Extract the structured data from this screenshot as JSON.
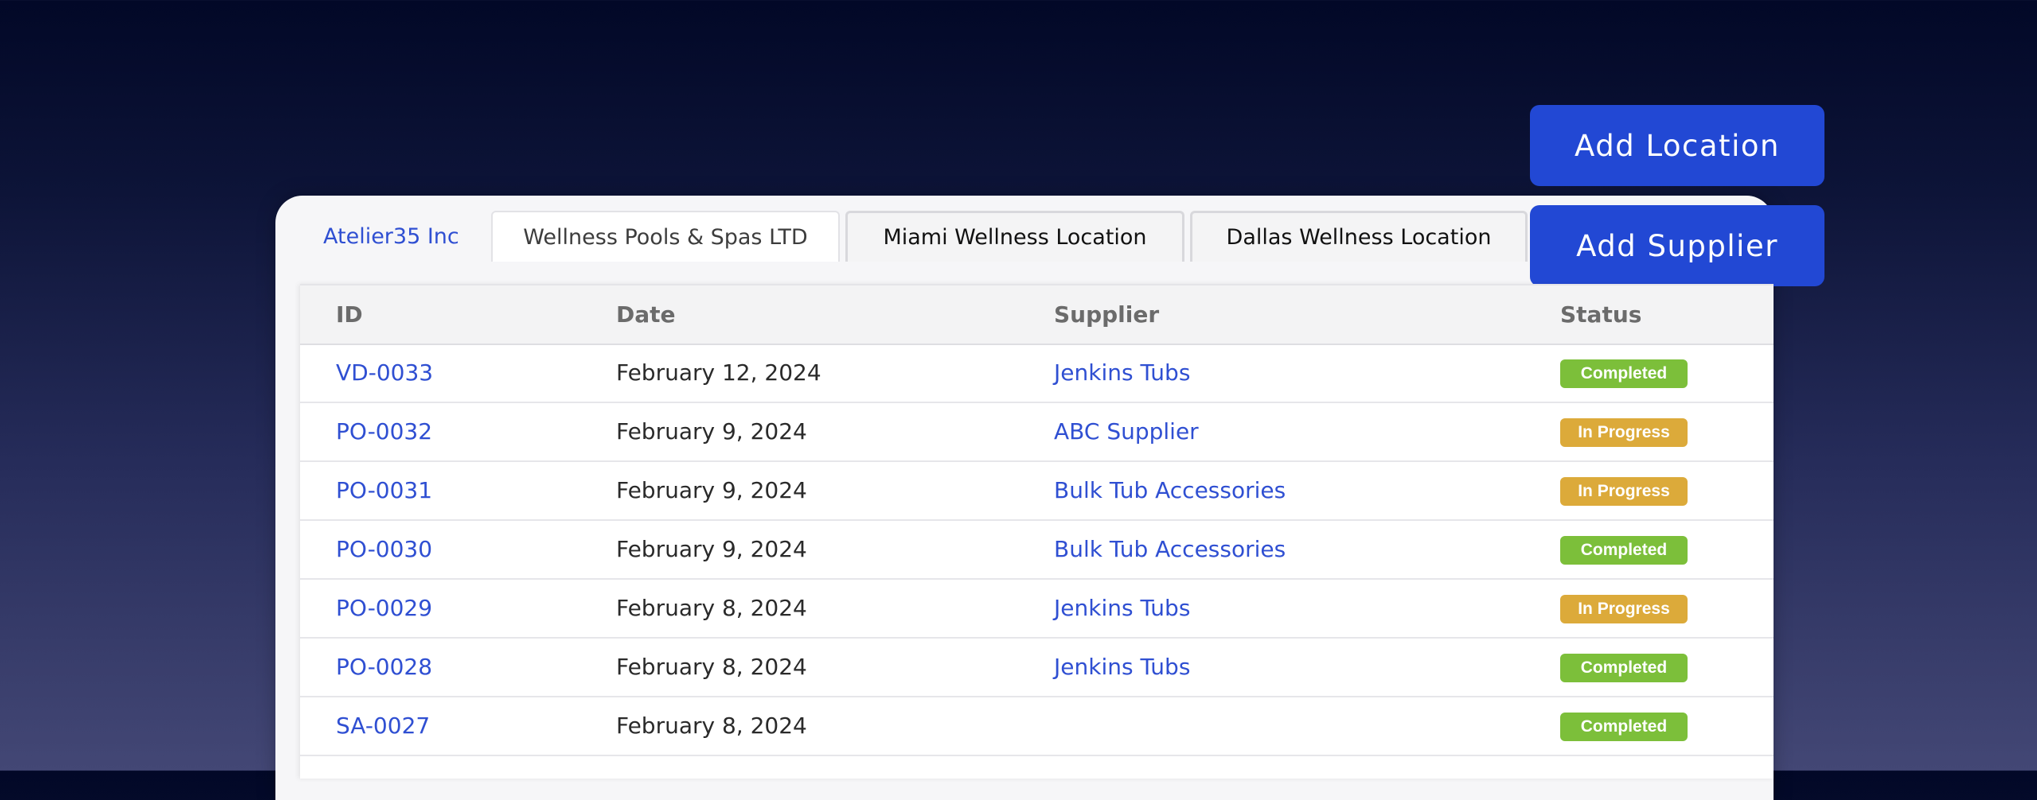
{
  "tabs": [
    {
      "label": "Atelier35 Inc",
      "state": "plain"
    },
    {
      "label": "Wellness Pools & Spas LTD",
      "state": "active"
    },
    {
      "label": "Miami Wellness Location",
      "state": "boxed"
    },
    {
      "label": "Dallas Wellness Location",
      "state": "boxed"
    }
  ],
  "actions": {
    "add_location_label": "Add Location",
    "add_supplier_label": "Add Supplier"
  },
  "table": {
    "columns": [
      "ID",
      "Date",
      "Supplier",
      "Status"
    ],
    "rows": [
      {
        "id": "VD-0033",
        "date": "February 12, 2024",
        "supplier": "Jenkins Tubs",
        "status": "Completed"
      },
      {
        "id": "PO-0032",
        "date": "February 9, 2024",
        "supplier": "ABC Supplier",
        "status": "In Progress"
      },
      {
        "id": "PO-0031",
        "date": "February 9, 2024",
        "supplier": "Bulk Tub Accessories",
        "status": "In Progress"
      },
      {
        "id": "PO-0030",
        "date": "February 9, 2024",
        "supplier": "Bulk Tub Accessories",
        "status": "Completed"
      },
      {
        "id": "PO-0029",
        "date": "February 8, 2024",
        "supplier": "Jenkins Tubs",
        "status": "In Progress"
      },
      {
        "id": "PO-0028",
        "date": "February 8, 2024",
        "supplier": "Jenkins Tubs",
        "status": "Completed"
      },
      {
        "id": "SA-0027",
        "date": "February 8, 2024",
        "supplier": "",
        "status": "Completed"
      }
    ]
  },
  "colors": {
    "accent": "#2248d4",
    "link": "#2f4fd2",
    "status_completed": "#7cbf3a",
    "status_in_progress": "#dcaa3a"
  }
}
